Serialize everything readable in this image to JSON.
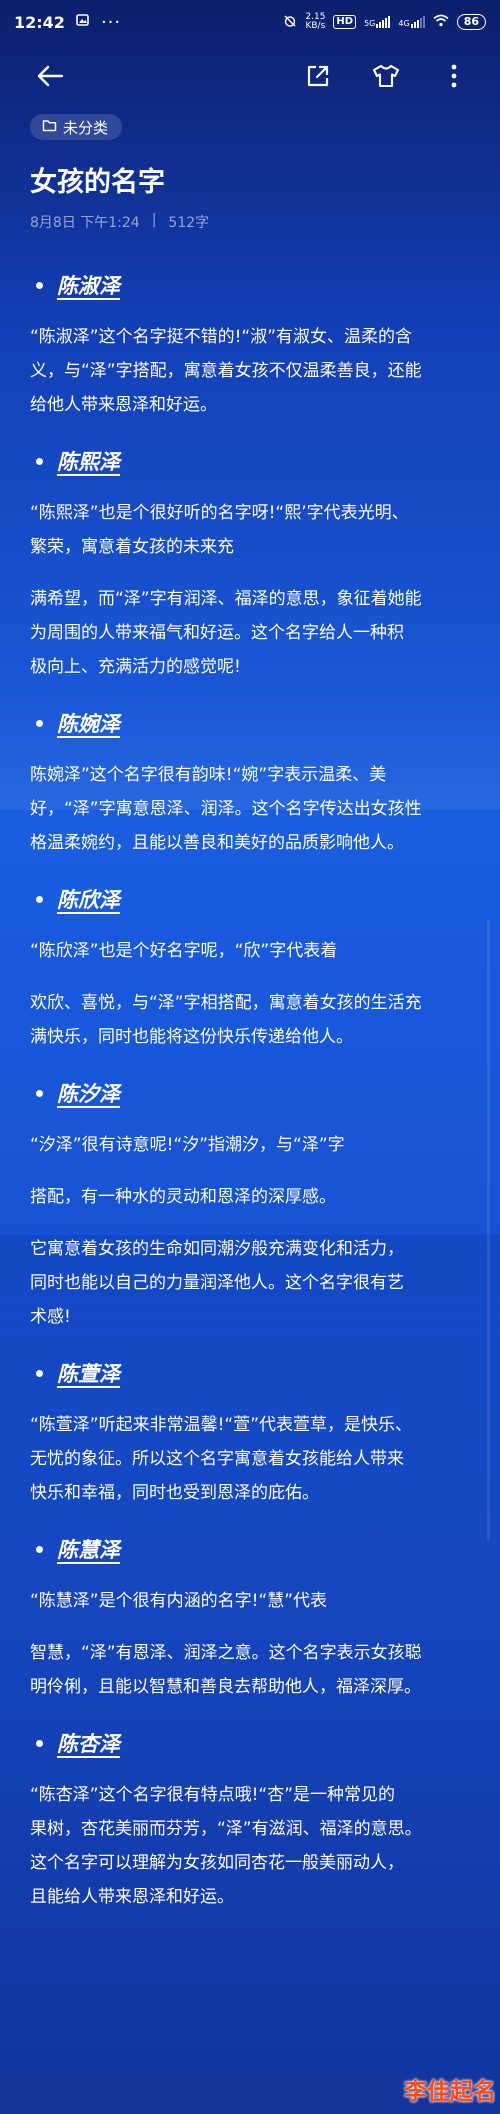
{
  "status_bar": {
    "time": "12:42",
    "network_speed": "2.15",
    "network_unit": "KB/s",
    "hd_label": "HD",
    "sig1_label": "5G",
    "sig2_label": "4G",
    "battery": "86"
  },
  "toolbar": {
    "icons": [
      "back-arrow-icon",
      "share-icon",
      "tshirt-theme-icon",
      "more-vertical-icon"
    ]
  },
  "category": "未分类",
  "note": {
    "title": "女孩的名字",
    "date": "8月8日 下午1:24",
    "separator": "|",
    "word_count": "512字"
  },
  "sections": [
    {
      "name": "陈淑泽",
      "paragraphs": [
        "“陈淑泽”这个名字挺不错的!“淑”有淑女、温柔的含\n义，与“泽”字搭配，寓意着女孩不仅温柔善良，还能\n给他人带来恩泽和好运。"
      ]
    },
    {
      "name": "陈熙泽",
      "paragraphs": [
        "“陈熙泽”也是个很好听的名字呀!“熙’字代表光明、\n繁荣，寓意着女孩的未来充",
        "满希望，而“泽”字有润泽、福泽的意思，象征着她能\n为周围的人带来福气和好运。这个名字给人一种积\n极向上、充满活力的感觉呢!"
      ]
    },
    {
      "name": "陈婉泽",
      "paragraphs": [
        "陈婉泽”这个名字很有韵味!“婉”字表示温柔、美\n好，“泽”字寓意恩泽、润泽。这个名字传达出女孩性\n格温柔婉约，且能以善良和美好的品质影响他人。"
      ]
    },
    {
      "name": "陈欣泽",
      "paragraphs": [
        "“陈欣泽”也是个好名字呢，“欣”字代表着",
        "欢欣、喜悦，与“泽”字相搭配，寓意着女孩的生活充\n满快乐，同时也能将这份快乐传递给他人。"
      ]
    },
    {
      "name": "陈汐泽",
      "paragraphs": [
        "“汐泽”很有诗意呢!“汐”指潮汐，与“泽”字",
        "搭配，有一种水的灵动和恩泽的深厚感。",
        "它寓意着女孩的生命如同潮汐般充满变化和活力，\n同时也能以自己的力量润泽他人。这个名字很有艺\n术感!"
      ]
    },
    {
      "name": "陈萱泽",
      "paragraphs": [
        "“陈萱泽”听起来非常温馨!“萱”代表萱草，是快乐、\n无忧的象征。所以这个名字寓意着女孩能给人带来\n快乐和幸福，同时也受到恩泽的庇佑。"
      ]
    },
    {
      "name": "陈慧泽",
      "paragraphs": [
        "“陈慧泽”是个很有内涵的名字!“慧”代表",
        "智慧，“泽”有恩泽、润泽之意。这个名字表示女孩聪\n明伶俐，且能以智慧和善良去帮助他人，福泽深厚。"
      ]
    },
    {
      "name": "陈杏泽",
      "paragraphs": [
        "“陈杏泽”这个名字很有特点哦!“杏”是一种常见的\n果树，杏花美丽而芬芳，“泽”有滋润、福泽的意思。\n这个名字可以理解为女孩如同杏花一般美丽动人，\n且能给人带来恩泽和好运。"
      ]
    }
  ],
  "watermark": "李佳起名"
}
